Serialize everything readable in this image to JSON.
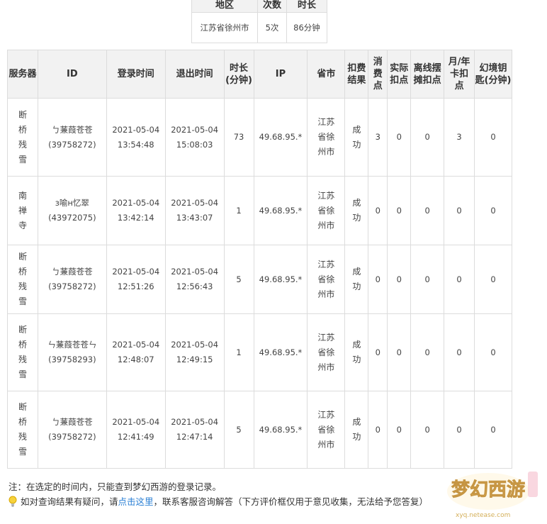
{
  "summary": {
    "headers": [
      "地区",
      "次数",
      "时长"
    ],
    "row": [
      "江苏省徐州市",
      "5次",
      "86分钟"
    ]
  },
  "records": {
    "headers": [
      {
        "lines": [
          "服务器"
        ]
      },
      {
        "lines": [
          "ID"
        ]
      },
      {
        "lines": [
          "登录时间"
        ]
      },
      {
        "lines": [
          "退出时间"
        ]
      },
      {
        "lines": [
          "时长",
          "(分钟)"
        ]
      },
      {
        "lines": [
          "IP"
        ]
      },
      {
        "lines": [
          "省市"
        ]
      },
      {
        "lines": [
          "扣费",
          "结果"
        ]
      },
      {
        "lines": [
          "消",
          "费",
          "点"
        ]
      },
      {
        "lines": [
          "实际",
          "扣点"
        ]
      },
      {
        "lines": [
          "离线摆",
          "摊扣点"
        ]
      },
      {
        "lines": [
          "月/年",
          "卡扣",
          "点"
        ]
      },
      {
        "lines": [
          "幻境钥",
          "匙(分钟)"
        ]
      }
    ],
    "rows": [
      {
        "server": "断桥残雪",
        "name": "ㄅ蒹葭苍苍",
        "uid": "(39758272)",
        "login_date": "2021-05-04",
        "login_time": "13:54:48",
        "logout_date": "2021-05-04",
        "logout_time": "15:08:03",
        "minutes": "73",
        "ip": "49.68.95.*",
        "region": "江苏省徐州市",
        "result": "成功",
        "consume": "3",
        "actual": "0",
        "offline": "0",
        "card": "3",
        "key": "0"
      },
      {
        "server": "南禅寺",
        "name": "з喻н忆翠",
        "uid": "(43972075)",
        "login_date": "2021-05-04",
        "login_time": "13:42:14",
        "logout_date": "2021-05-04",
        "logout_time": "13:43:07",
        "minutes": "1",
        "ip": "49.68.95.*",
        "region": "江苏省徐州市",
        "result": "成功",
        "consume": "0",
        "actual": "0",
        "offline": "0",
        "card": "0",
        "key": "0"
      },
      {
        "server": "断桥残雪",
        "name": "ㄅ蒹葭苍苍",
        "uid": "(39758272)",
        "login_date": "2021-05-04",
        "login_time": "12:51:26",
        "logout_date": "2021-05-04",
        "logout_time": "12:56:43",
        "minutes": "5",
        "ip": "49.68.95.*",
        "region": "江苏省徐州市",
        "result": "成功",
        "consume": "0",
        "actual": "0",
        "offline": "0",
        "card": "0",
        "key": "0"
      },
      {
        "server": "断桥残雪",
        "name": "ㄣ蒹葭苍苍ㄣ",
        "uid": "(39758293)",
        "login_date": "2021-05-04",
        "login_time": "12:48:07",
        "logout_date": "2021-05-04",
        "logout_time": "12:49:15",
        "minutes": "1",
        "ip": "49.68.95.*",
        "region": "江苏省徐州市",
        "result": "成功",
        "consume": "0",
        "actual": "0",
        "offline": "0",
        "card": "0",
        "key": "0"
      },
      {
        "server": "断桥残雪",
        "name": "ㄅ蒹葭苍苍",
        "uid": "(39758272)",
        "login_date": "2021-05-04",
        "login_time": "12:41:49",
        "logout_date": "2021-05-04",
        "logout_time": "12:47:14",
        "minutes": "5",
        "ip": "49.68.95.*",
        "region": "江苏省徐州市",
        "result": "成功",
        "consume": "0",
        "actual": "0",
        "offline": "0",
        "card": "0",
        "key": "0"
      }
    ]
  },
  "note": "注：在选定的时间内，只能查到梦幻西游的登录记录。",
  "help": {
    "prefix": "如对查询结果有疑问，请",
    "link": "点击这里",
    "suffix": "，联系客服咨询解答（下方评价框仅用于意见收集，无法给予您答复）"
  },
  "logo": {
    "text": "梦幻西游",
    "sub": "xyq.netease.com",
    "color": "#e8b23a"
  },
  "icons": {
    "help": "lightbulb-icon",
    "logo": "mhxy-logo"
  }
}
